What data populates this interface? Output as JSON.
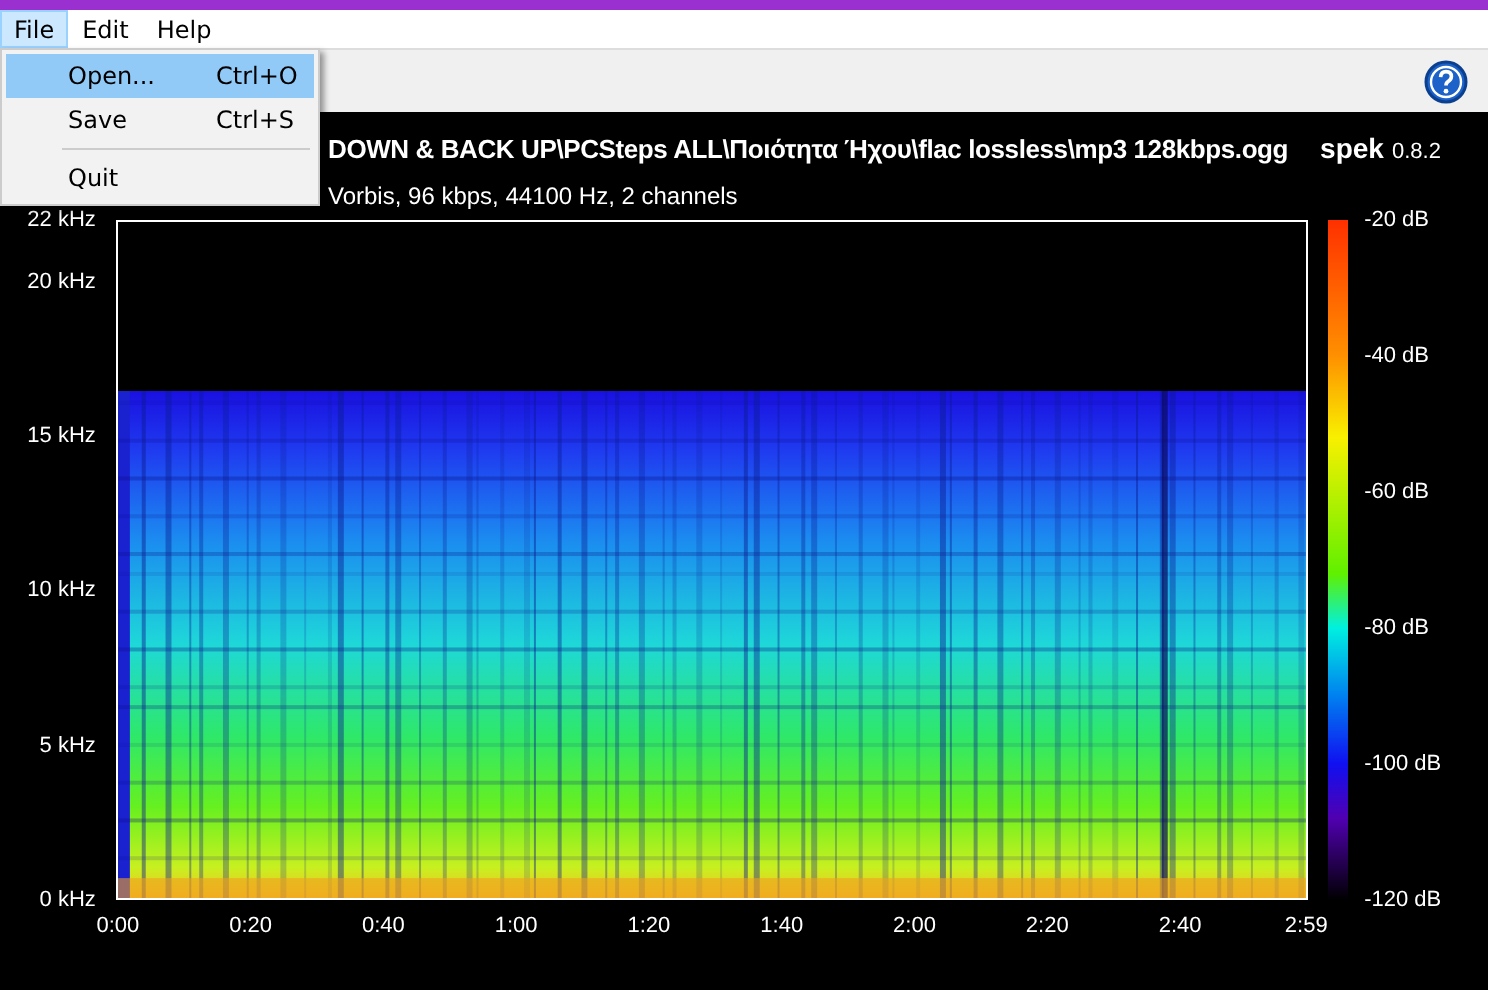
{
  "menu_bar": [
    {
      "label": "File",
      "selected": true
    },
    {
      "label": "Edit",
      "selected": false
    },
    {
      "label": "Help",
      "selected": false
    }
  ],
  "file_menu": [
    {
      "kind": "item",
      "label": "Open...",
      "shortcut": "Ctrl+O",
      "selected": true
    },
    {
      "kind": "item",
      "label": "Save",
      "shortcut": "Ctrl+S",
      "selected": false
    },
    {
      "kind": "separator"
    },
    {
      "kind": "item",
      "label": "Quit",
      "selected": false
    }
  ],
  "header": {
    "file_path": "DOWN & BACK UP\\PCSteps ALL\\Ποιότητα Ήχου\\flac lossless\\mp3 128kbps.ogg",
    "app_name": "spek",
    "version": "0.8.2",
    "stream_info": "Vorbis, 96 kbps, 44100 Hz, 2 channels"
  },
  "frequency_axis": [
    "22 kHz",
    "20 kHz",
    "15 kHz",
    "10 kHz",
    "5 kHz",
    "0 kHz"
  ],
  "time_axis": [
    "0:00",
    "0:20",
    "0:40",
    "1:00",
    "1:20",
    "1:40",
    "2:00",
    "2:20",
    "2:40",
    "2:59"
  ],
  "level_axis": [
    "-20 dB",
    "-40 dB",
    "-60 dB",
    "-80 dB",
    "-100 dB",
    "-120 dB"
  ]
}
